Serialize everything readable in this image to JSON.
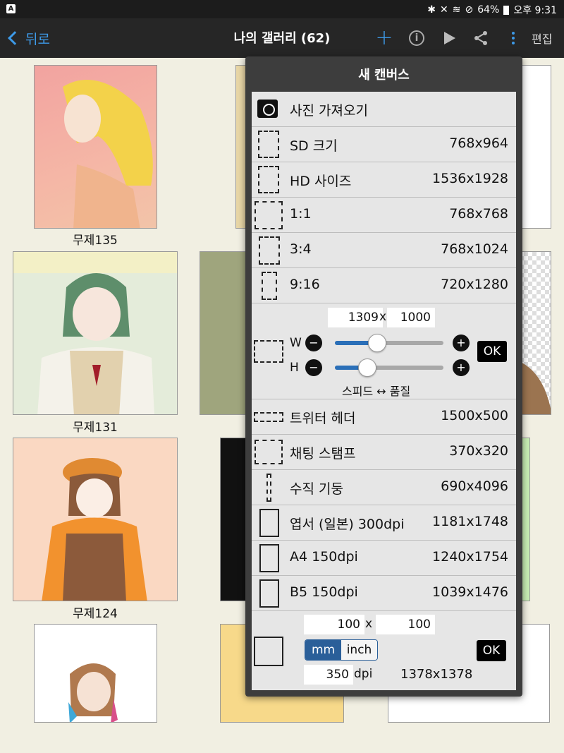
{
  "status_bar": {
    "battery": "64%",
    "time": "오후 9:31",
    "icons": [
      "bluetooth-icon",
      "mute-icon",
      "wifi-icon",
      "no-disturb-icon",
      "battery-icon"
    ]
  },
  "nav": {
    "back_label": "뒤로",
    "title": "나의 갤러리 (62)",
    "edit_label": "편집",
    "icons": [
      "plus-icon",
      "info-icon",
      "play-icon",
      "share-icon",
      "more-icon"
    ]
  },
  "gallery": {
    "labels": [
      "무제135",
      "무제131",
      "무제124"
    ]
  },
  "dialog": {
    "title": "새 캔버스",
    "import_label": "사진 가져오기",
    "presets": [
      {
        "label": "SD 크기",
        "size": "768x964"
      },
      {
        "label": "HD 사이즈",
        "size": "1536x1928"
      },
      {
        "label": "1:1",
        "size": "768x768"
      },
      {
        "label": "3:4",
        "size": "768x1024"
      },
      {
        "label": "9:16",
        "size": "720x1280"
      }
    ],
    "custom": {
      "width": "1309",
      "x": "x",
      "height": "1000",
      "w_label": "W",
      "h_label": "H",
      "w_slider": 0.39,
      "h_slider": 0.3,
      "ok_label": "OK",
      "hint": "스피드 ↔ 품질"
    },
    "presets2": [
      {
        "label": "트위터 헤더",
        "size": "1500x500"
      },
      {
        "label": "채팅 스탬프",
        "size": "370x320"
      },
      {
        "label": "수직 기둥",
        "size": "690x4096"
      },
      {
        "label": "엽서 (일본) 300dpi",
        "size": "1181x1748"
      },
      {
        "label": "A4 150dpi",
        "size": "1240x1754"
      },
      {
        "label": "B5 150dpi",
        "size": "1039x1476"
      }
    ],
    "physical": {
      "width": "100",
      "x": "x",
      "height": "100",
      "unit_mm": "mm",
      "unit_inch": "inch",
      "selected_unit": "mm",
      "dpi": "350",
      "dpi_label": "dpi",
      "pixel_size": "1378x1378",
      "ok_label": "OK"
    }
  }
}
